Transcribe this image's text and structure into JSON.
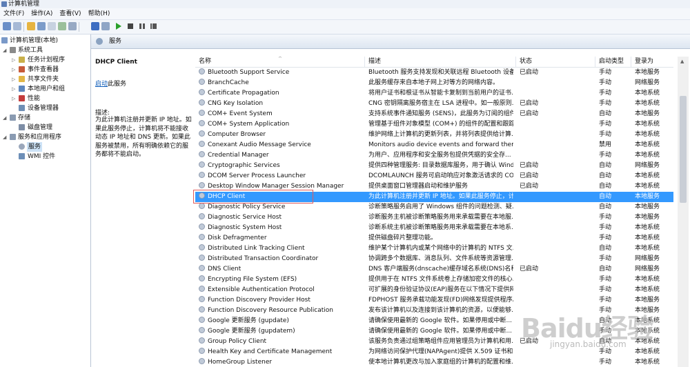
{
  "window": {
    "title": "计算机管理"
  },
  "menu": [
    "文件(F)",
    "操作(A)",
    "查看(V)",
    "帮助(H)"
  ],
  "tree": {
    "root": "计算机管理(本地)",
    "system_tools": "系统工具",
    "task_scheduler": "任务计划程序",
    "event_viewer": "事件查看器",
    "shared_folders": "共享文件夹",
    "local_users": "本地用户和组",
    "performance": "性能",
    "device_manager": "设备管理器",
    "storage": "存储",
    "disk_management": "磁盘管理",
    "services_apps": "服务和应用程序",
    "services": "服务",
    "wmi": "WMI 控件"
  },
  "header": {
    "title": "服务"
  },
  "details": {
    "service_name": "DHCP Client",
    "start_link": "启动",
    "start_suffix": "此服务",
    "desc_label": "描述:",
    "desc_text": "为此计算机注册并更新 IP 地址。如果此服务停止，计算机将不能接收动态 IP 地址和 DNS 更新。如果此服务被禁用，所有明确依赖它的服务都将不能启动。"
  },
  "columns": {
    "name": "名称",
    "desc": "描述",
    "status": "状态",
    "start_type": "启动类型",
    "logon": "登录为"
  },
  "services": [
    {
      "name": "Bluetooth Support Service",
      "desc": "Bluetooth 服务支持发现和关联远程 Bluetooth 设备...",
      "status": "已启动",
      "start": "手动",
      "logon": "本地服务"
    },
    {
      "name": "BranchCache",
      "desc": "此服务缓存来自本地子网上对等方的网络内容。",
      "status": "",
      "start": "手动",
      "logon": "网络服务"
    },
    {
      "name": "Certificate Propagation",
      "desc": "将用户证书和根证书从智能卡复制到当前用户的证书...",
      "status": "",
      "start": "手动",
      "logon": "本地系统"
    },
    {
      "name": "CNG Key Isolation",
      "desc": "CNG 密钥隔离服务宿主在 LSA 进程中。如一般原则...",
      "status": "已启动",
      "start": "手动",
      "logon": "本地系统"
    },
    {
      "name": "COM+ Event System",
      "desc": "支持系统事件通知服务 (SENS)，此服务为订阅的组件...",
      "status": "已启动",
      "start": "自动",
      "logon": "本地服务"
    },
    {
      "name": "COM+ System Application",
      "desc": "管理基于组件对象模型 (COM+) 的组件的配置和跟踪...",
      "status": "",
      "start": "手动",
      "logon": "本地系统"
    },
    {
      "name": "Computer Browser",
      "desc": "维护网络上计算机的更新列表，并将列表提供给计算...",
      "status": "",
      "start": "手动",
      "logon": "本地系统"
    },
    {
      "name": "Conexant Audio Message Service",
      "desc": "Monitors audio device events and forward them ...",
      "status": "",
      "start": "禁用",
      "logon": "本地系统"
    },
    {
      "name": "Credential Manager",
      "desc": "为用户、应用程序和安全服务包提供凭据的安全存...",
      "status": "",
      "start": "手动",
      "logon": "本地系统"
    },
    {
      "name": "Cryptographic Services",
      "desc": "提供四种管理服务: 目录数据库服务，用于确认 Wind...",
      "status": "已启动",
      "start": "自动",
      "logon": "网络服务"
    },
    {
      "name": "DCOM Server Process Launcher",
      "desc": "DCOMLAUNCH 服务可启动响应对象激活请求的 COM...",
      "status": "已启动",
      "start": "自动",
      "logon": "本地系统"
    },
    {
      "name": "Desktop Window Manager Session Manager",
      "desc": "提供桌面窗口管理器启动和维护服务",
      "status": "已启动",
      "start": "自动",
      "logon": "本地系统"
    },
    {
      "name": "DHCP Client",
      "desc": "为此计算机注册并更新 IP 地址。如果此服务停止，计...",
      "status": "",
      "start": "自动",
      "logon": "本地服务",
      "selected": true
    },
    {
      "name": "Diagnostic Policy Service",
      "desc": "诊断策略服务启用了 Windows 组件的问题检测、疑...",
      "status": "",
      "start": "自动",
      "logon": "本地服务"
    },
    {
      "name": "Diagnostic Service Host",
      "desc": "诊断服务主机被诊断策略服务用来承载需要在本地服...",
      "status": "",
      "start": "手动",
      "logon": "本地服务"
    },
    {
      "name": "Diagnostic System Host",
      "desc": "诊断系统主机被诊断策略服务用来承载需要在本地系...",
      "status": "",
      "start": "手动",
      "logon": "本地系统"
    },
    {
      "name": "Disk Defragmenter",
      "desc": "提供磁盘碎片整理功能。",
      "status": "",
      "start": "手动",
      "logon": "本地系统"
    },
    {
      "name": "Distributed Link Tracking Client",
      "desc": "维护某个计算机内或某个网络中的计算机的 NTFS 文...",
      "status": "",
      "start": "自动",
      "logon": "本地系统"
    },
    {
      "name": "Distributed Transaction Coordinator",
      "desc": "协调跨多个数据库、消息队列、文件系统等资源管理...",
      "status": "",
      "start": "手动",
      "logon": "网络服务"
    },
    {
      "name": "DNS Client",
      "desc": "DNS 客户端服务(dnscache)缓存域名系统(DNS)名称...",
      "status": "已启动",
      "start": "自动",
      "logon": "网络服务"
    },
    {
      "name": "Encrypting File System (EFS)",
      "desc": "提供用于在 NTFS 文件系统卷上存储加密文件的核心...",
      "status": "",
      "start": "手动",
      "logon": "本地系统"
    },
    {
      "name": "Extensible Authentication Protocol",
      "desc": "可扩展的身份验证协议(EAP)服务在以下情况下提供网...",
      "status": "",
      "start": "手动",
      "logon": "本地系统"
    },
    {
      "name": "Function Discovery Provider Host",
      "desc": "FDPHOST 服务承载功能发现(FD)网络发现提供程序。...",
      "status": "",
      "start": "手动",
      "logon": "本地服务"
    },
    {
      "name": "Function Discovery Resource Publication",
      "desc": "发布该计算机以及连接到该计算机的资源，以便能够...",
      "status": "",
      "start": "手动",
      "logon": "本地服务"
    },
    {
      "name": "Google 更新服务 (gupdate)",
      "desc": "请确保使用最新的 Google 软件。如果停用或中断...",
      "status": "",
      "start": "自动",
      "logon": "本地系统"
    },
    {
      "name": "Google 更新服务 (gupdatem)",
      "desc": "请确保使用最新的 Google 软件。如果停用或中断...",
      "status": "",
      "start": "手动",
      "logon": "本地系统"
    },
    {
      "name": "Group Policy Client",
      "desc": "该服务负责通过组策略组件应用管理员为计算机和用...",
      "status": "已启动",
      "start": "自动",
      "logon": "本地系统"
    },
    {
      "name": "Health Key and Certificate Management",
      "desc": "为网络访问保护代理(NAPAgent)提供 X.509 证书和...",
      "status": "",
      "start": "手动",
      "logon": "本地系统"
    },
    {
      "name": "HomeGroup Listener",
      "desc": "使本地计算机更改与加入家庭组的计算机的配置和维...",
      "status": "",
      "start": "手动",
      "logon": "本地系统"
    }
  ],
  "watermark": {
    "text": "Baidu经验",
    "url": "jingyan.baidu.com"
  }
}
